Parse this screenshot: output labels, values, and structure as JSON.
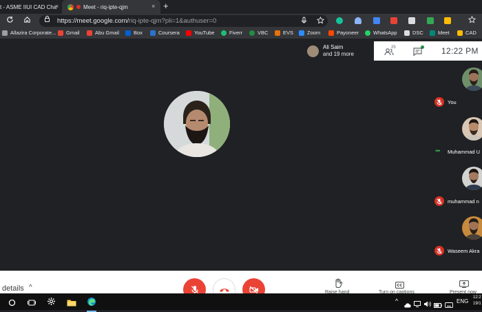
{
  "browser": {
    "tabs": [
      {
        "title": "t - ASME IIUI CAD Cha",
        "active": false
      },
      {
        "title": "Meet - riq-ipte-qjm",
        "active": true
      }
    ],
    "new_tab": "+",
    "close_glyph": "×",
    "url_main": "https://meet.google.com/",
    "url_dim": "riq-ipte-qjm?pli=1&authuser=0",
    "bookmarks": [
      {
        "label": "Allazira Corporate...",
        "color": "#9aa0a6"
      },
      {
        "label": "Gmail",
        "color": "#ea4335"
      },
      {
        "label": "Abu Gmail",
        "color": "#ea4335"
      },
      {
        "label": "Box",
        "color": "#0061d5"
      },
      {
        "label": "Coursera",
        "color": "#2a73cc"
      },
      {
        "label": "YouTube",
        "color": "#ff0000"
      },
      {
        "label": "Fiverr",
        "color": "#1dbf73"
      },
      {
        "label": "VBC",
        "color": "#1e8e3e"
      },
      {
        "label": "EVS",
        "color": "#e8710a"
      },
      {
        "label": "Zoom",
        "color": "#2d8cff"
      },
      {
        "label": "Payoneer",
        "color": "#ff4800"
      },
      {
        "label": "WhatsApp",
        "color": "#25d366"
      },
      {
        "label": "DSC",
        "color": "#dadce0"
      },
      {
        "label": "Meet",
        "color": "#00897b"
      },
      {
        "label": "CAD",
        "color": "#fbbc04"
      }
    ]
  },
  "meet": {
    "presenter_card": {
      "name": "Ali Saim",
      "more": "and 19 more"
    },
    "people_count": "25",
    "clock": "12:22 PM",
    "participants": [
      {
        "name": "You",
        "muted": true
      },
      {
        "name": "Muhammad U",
        "muted": false,
        "speaking": true
      },
      {
        "name": "muhammad n",
        "muted": true
      },
      {
        "name": "Waseem Akra",
        "muted": true
      }
    ],
    "speaking_dots": "•••",
    "bottom": {
      "details_label": "details",
      "chevron": "^",
      "raise_hand": "Raise hand",
      "captions": "Turn on captions",
      "present": "Present now"
    }
  },
  "taskbar": {
    "lang": "ENG",
    "time": "12:2",
    "date": "19/1"
  },
  "colors": {
    "meet_red": "#ea4335",
    "mic_muted_red": "#d93025",
    "dark_bg": "#202124",
    "chrome_bar": "#35363a"
  }
}
